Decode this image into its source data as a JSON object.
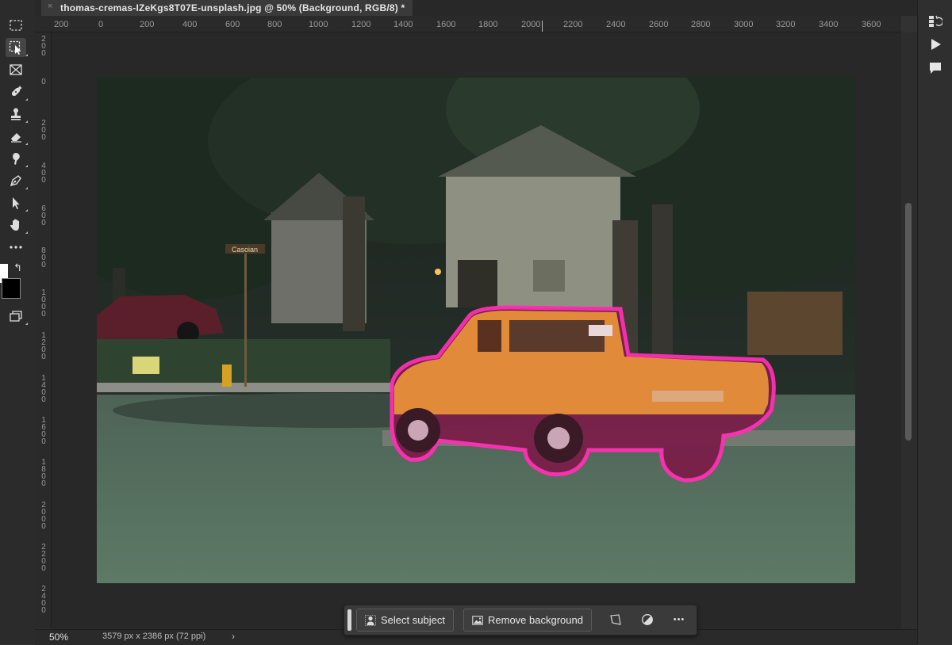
{
  "document": {
    "tab_title": "thomas-cremas-IZeKgs8T07E-unsplash.jpg @ 50% (Background, RGB/8) *",
    "close_glyph": "×"
  },
  "rulers": {
    "horizontal": [
      "200",
      "0",
      "200",
      "400",
      "600",
      "800",
      "1000",
      "1200",
      "1400",
      "1600",
      "1800",
      "2000",
      "2200",
      "2400",
      "2600",
      "2800",
      "3000",
      "3200",
      "3400",
      "3600"
    ],
    "vertical": [
      "200",
      "0",
      "200",
      "400",
      "600",
      "800",
      "1000",
      "1200",
      "1400",
      "1600",
      "1800",
      "2000",
      "2200",
      "2400"
    ]
  },
  "photo": {
    "street_sign": "Casoian"
  },
  "toolbar": {
    "tools": [
      "marquee-icon",
      "object-selection-icon",
      "frame-icon",
      "healing-brush-icon",
      "stamp-icon",
      "eraser-icon",
      "smudge-icon",
      "pen-icon",
      "direct-selection-icon",
      "hand-icon",
      "more-tools-icon"
    ],
    "foreground_color": "#ffffff",
    "background_color": "#000000"
  },
  "status": {
    "zoom": "50%",
    "doc_info": "3579 px x 2386 px (72 ppi)",
    "arrow": "›"
  },
  "taskbar": {
    "select_subject": "Select subject",
    "remove_background": "Remove background",
    "more": "•••"
  },
  "colors": {
    "selection_outline": "#ff2fb3",
    "truck": "#e08a3a",
    "mask_overlay": "#7a1f4a"
  }
}
